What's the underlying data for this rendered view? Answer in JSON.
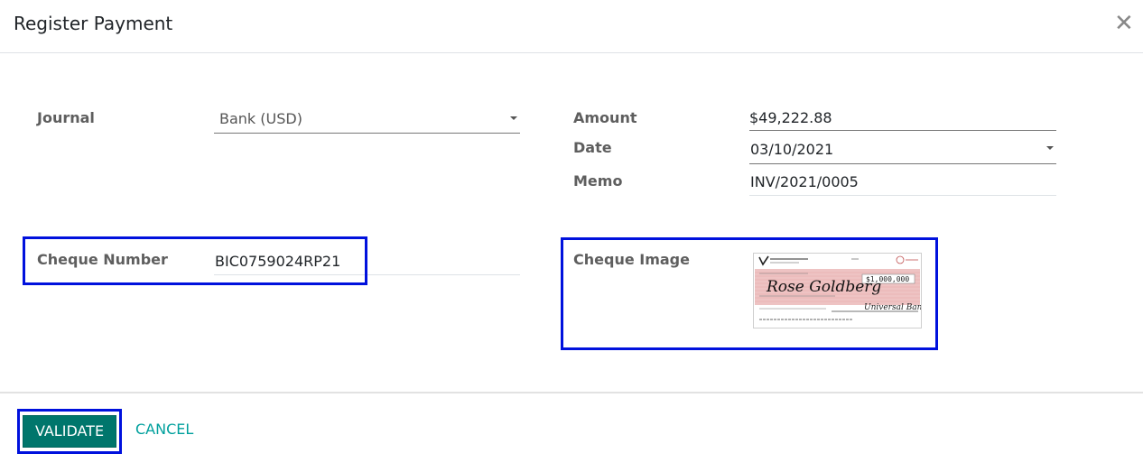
{
  "dialog": {
    "title": "Register Payment",
    "close_icon": "close-icon"
  },
  "form": {
    "journal": {
      "label": "Journal",
      "value": "Bank (USD)"
    },
    "amount": {
      "label": "Amount",
      "value": "$49,222.88"
    },
    "date": {
      "label": "Date",
      "value": "03/10/2021"
    },
    "memo": {
      "label": "Memo",
      "value": "INV/2021/0005"
    },
    "cheque_number": {
      "label": "Cheque Number",
      "value": "BIC0759024RP21"
    },
    "cheque_image": {
      "label": "Cheque Image",
      "payee": "Rose Goldberg",
      "amount": "$1,000,000",
      "signature": "Universal Bank"
    }
  },
  "footer": {
    "validate_label": "VALIDATE",
    "cancel_label": "CANCEL"
  },
  "colors": {
    "primary": "#00766c",
    "link": "#00a09d",
    "highlight": "#0011dd"
  }
}
